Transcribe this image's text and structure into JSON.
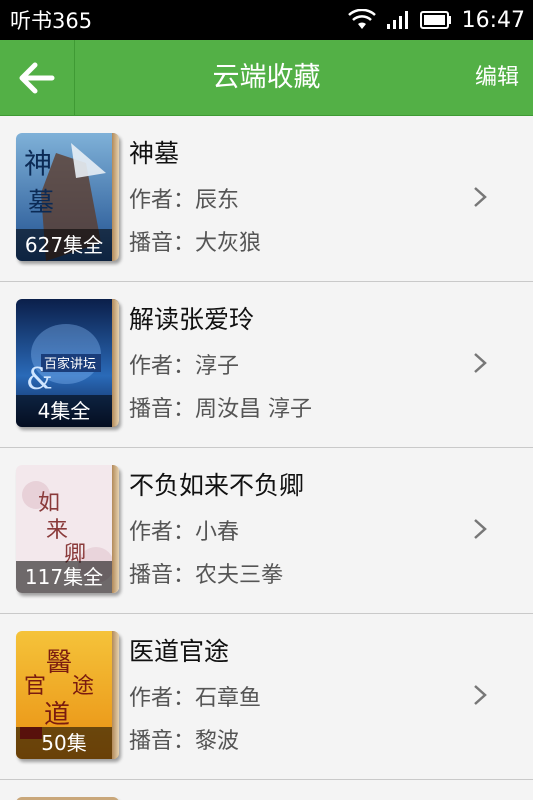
{
  "status_bar": {
    "app_label": "听书365",
    "time": "16:47"
  },
  "header": {
    "title": "云端收藏",
    "edit_label": "编辑"
  },
  "books": [
    {
      "title": "神墓",
      "author_label": "作者：辰东",
      "narrator_label": "播音：大灰狼",
      "episodes": "627集全",
      "cover_colors": [
        "#1f4f8f",
        "#7fb1d8"
      ]
    },
    {
      "title": "解读张爱玲",
      "author_label": "作者：淳子",
      "narrator_label": "播音：周汝昌 淳子",
      "episodes": "4集全",
      "cover_colors": [
        "#0b1f4a",
        "#2a6ab8"
      ]
    },
    {
      "title": "不负如来不负卿",
      "author_label": "作者：小春",
      "narrator_label": "播音：农夫三拳",
      "episodes": "117集全",
      "cover_colors": [
        "#f2e6ea",
        "#d9b8c2"
      ]
    },
    {
      "title": "医道官途",
      "author_label": "作者：石章鱼",
      "narrator_label": "播音：黎波",
      "episodes": "50集",
      "cover_colors": [
        "#f1b62a",
        "#e98f12"
      ]
    }
  ],
  "colors": {
    "header_green": "#53b046",
    "status_black": "#000000"
  }
}
